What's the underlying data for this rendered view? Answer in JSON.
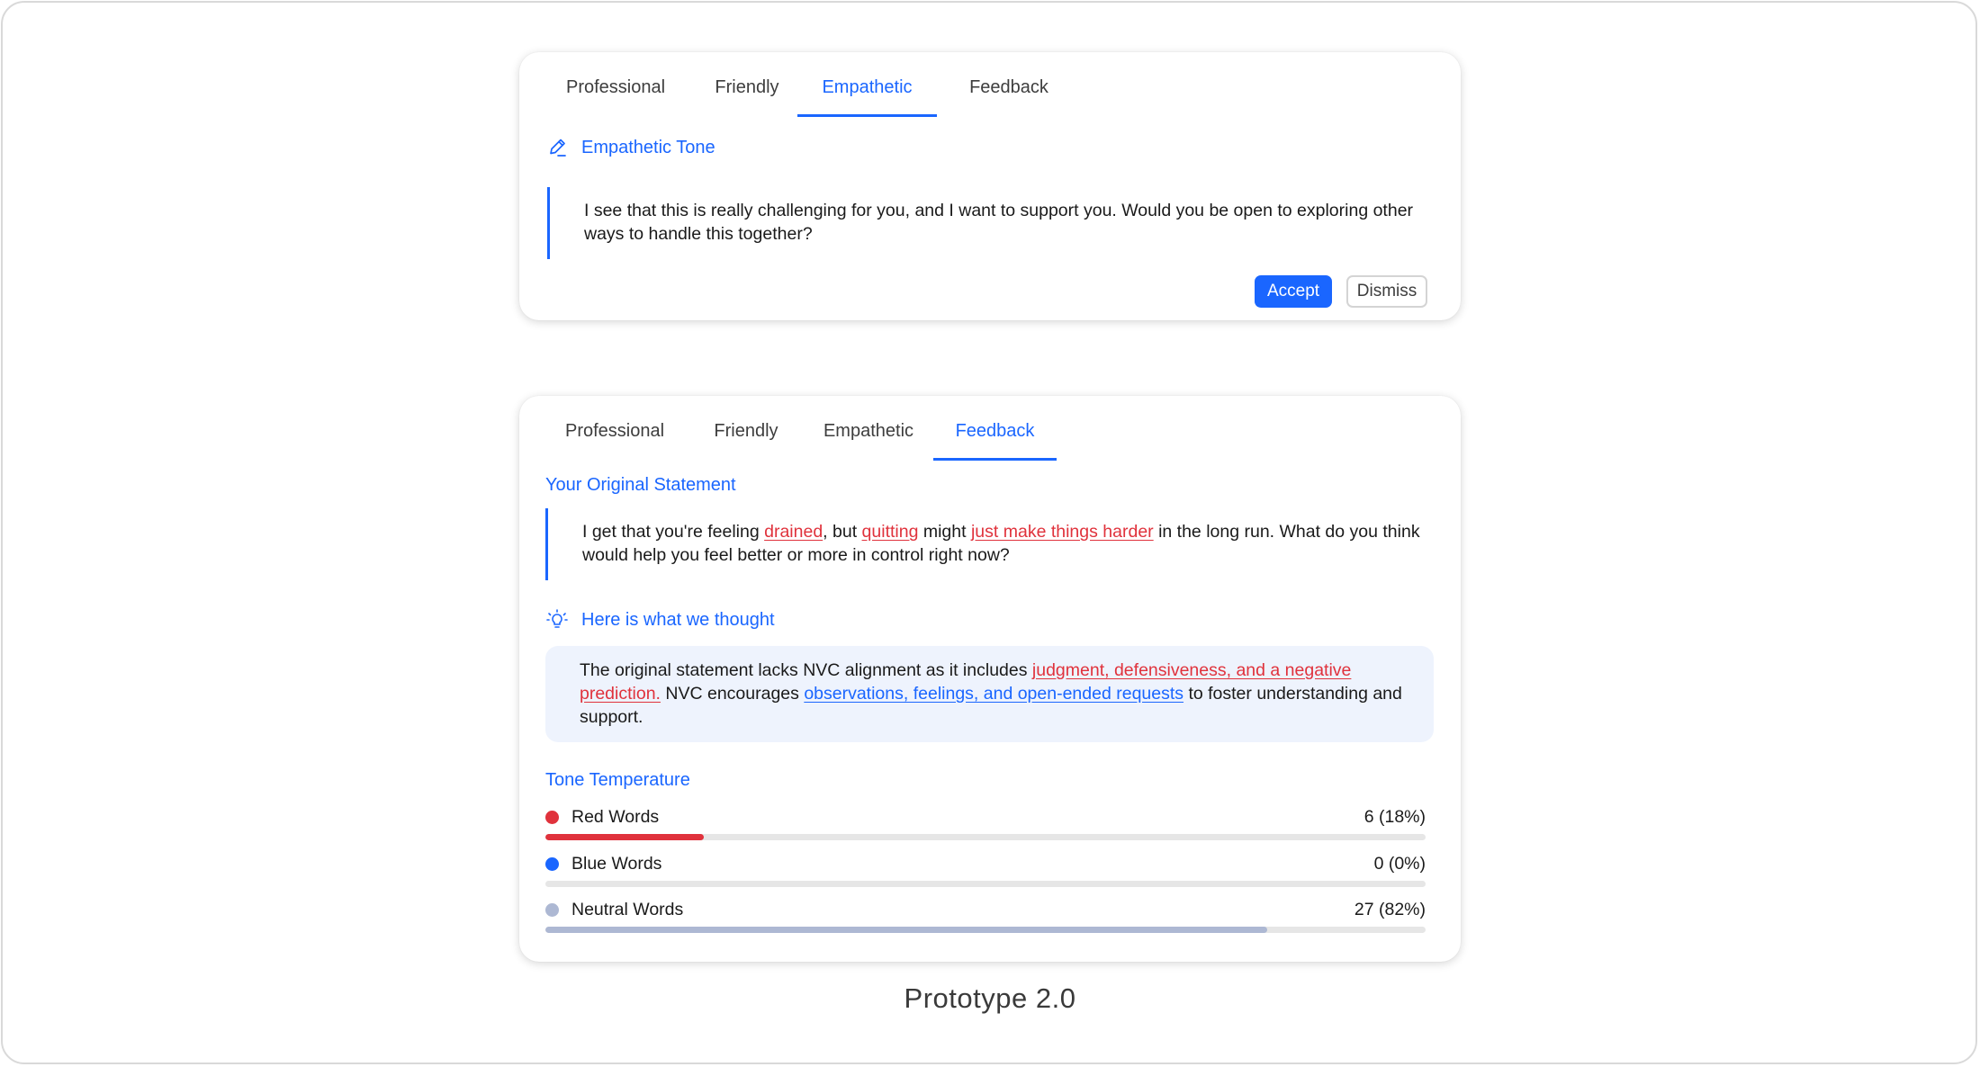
{
  "card_empathetic": {
    "tabs": [
      "Professional",
      "Friendly",
      "Empathetic",
      "Feedback"
    ],
    "active_tab": "Empathetic",
    "section_title": "Empathetic Tone",
    "suggestion": "I see that this is really challenging for you, and I want to support you. Would you be open to exploring other ways to handle this together?",
    "accept_label": "Accept",
    "dismiss_label": "Dismiss"
  },
  "card_feedback": {
    "tabs": [
      "Professional",
      "Friendly",
      "Empathetic",
      "Feedback"
    ],
    "active_tab": "Feedback",
    "original_title": "Your Original Statement",
    "original_segments": [
      {
        "text": "I get that you're feeling ",
        "type": "plain"
      },
      {
        "text": "drained",
        "type": "red"
      },
      {
        "text": ", but ",
        "type": "plain"
      },
      {
        "text": "quitting",
        "type": "red"
      },
      {
        "text": " might ",
        "type": "plain"
      },
      {
        "text": "just make things harder",
        "type": "red"
      },
      {
        "text": " in the long run. What do you think would help you feel better or more in control right now?",
        "type": "plain"
      }
    ],
    "thought_title": "Here is what we thought",
    "thought_segments": [
      {
        "text": "The original statement lacks NVC alignment as it includes ",
        "type": "plain"
      },
      {
        "text": "judgment, defensiveness, and a negative prediction.",
        "type": "red"
      },
      {
        "text": " NVC encourages ",
        "type": "plain"
      },
      {
        "text": "observations, feelings, and open-ended requests",
        "type": "blue"
      },
      {
        "text": " to foster understanding and support.",
        "type": "plain"
      }
    ],
    "tone_title": "Tone Temperature",
    "metrics": [
      {
        "label": "Red Words",
        "value": "6 (18%)",
        "fraction": 0.18,
        "color": "#e0323c"
      },
      {
        "label": "Blue Words",
        "value": "0 (0%)",
        "fraction": 0.0,
        "color": "#1a66ff"
      },
      {
        "label": "Neutral Words",
        "value": "27 (82%)",
        "fraction": 0.82,
        "color": "#adb8d3"
      }
    ]
  },
  "caption": "Prototype 2.0",
  "colors": {
    "accent": "#1a66ff",
    "red": "#e0323c",
    "neutral": "#adb8d3"
  }
}
